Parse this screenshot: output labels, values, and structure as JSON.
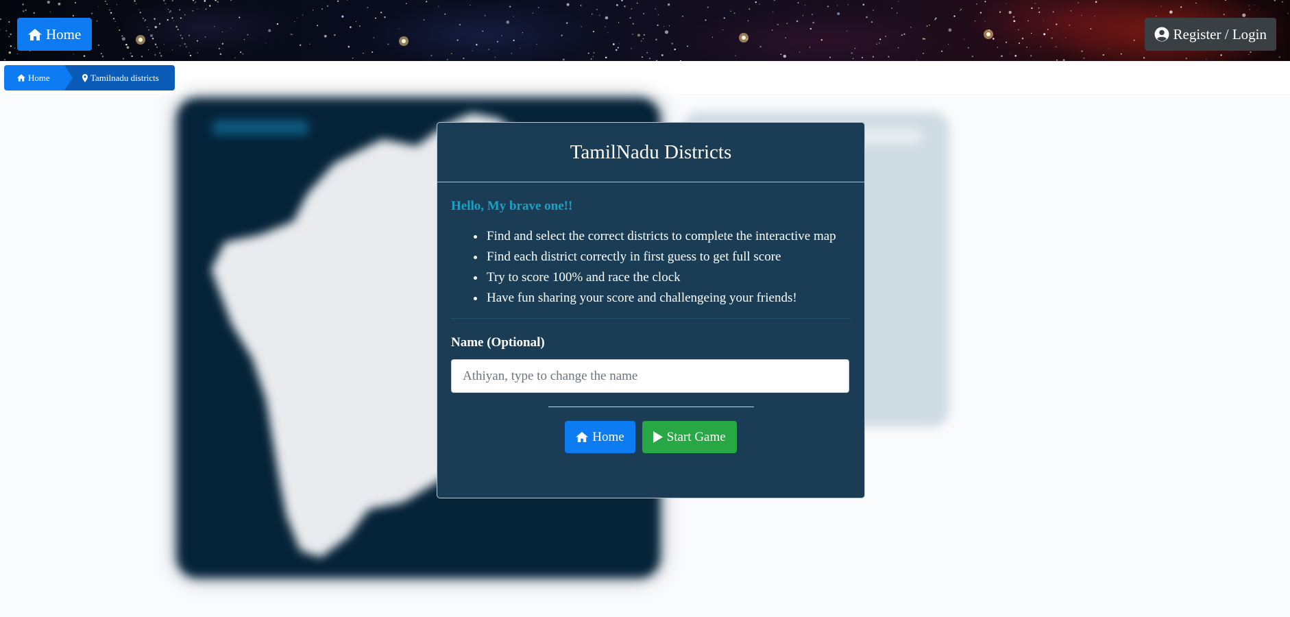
{
  "header": {
    "home_label": "Home",
    "login_label": "Register / Login"
  },
  "breadcrumb": {
    "items": [
      {
        "label": "Home",
        "icon": "home-icon"
      },
      {
        "label": "Tamilnadu districts",
        "icon": "map-marker-icon"
      }
    ]
  },
  "modal": {
    "title": "TamilNadu Districts",
    "greeting": "Hello, My brave one!!",
    "rules": [
      "Find and select the correct districts to complete the interactive map",
      "Find each district correctly in first guess to get full score",
      "Try to score 100% and race the clock",
      "Have fun sharing your score and challengeing your friends!"
    ],
    "name_label": "Name (Optional)",
    "name_placeholder": "Athiyan, type to change the name",
    "home_button": "Home",
    "start_button": "Start Game"
  },
  "colors": {
    "primary": "#0d7cf2",
    "success": "#28a745",
    "modal_bg": "#1a3d55",
    "greeting": "#17a2c8",
    "dark_button": "#3a3f44"
  }
}
